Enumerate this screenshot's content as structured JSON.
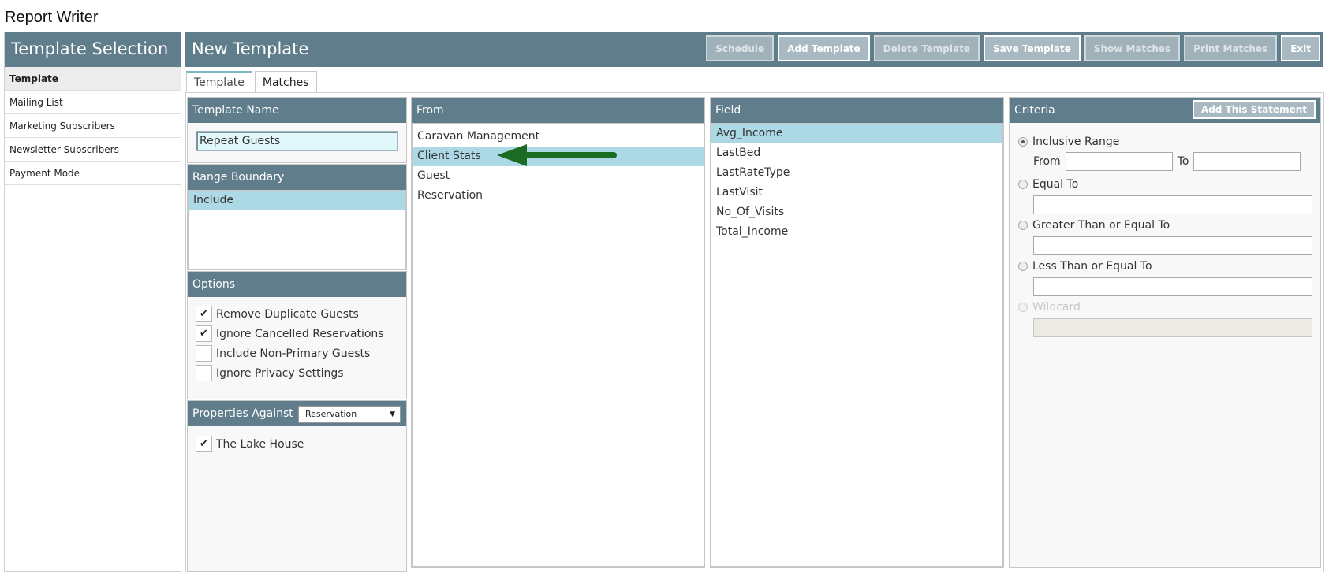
{
  "app": {
    "title": "Report Writer"
  },
  "sidebar": {
    "header": "Template Selection",
    "items": [
      {
        "label": "Template",
        "active": true
      },
      {
        "label": "Mailing List"
      },
      {
        "label": "Marketing Subscribers"
      },
      {
        "label": "Newsletter Subscribers"
      },
      {
        "label": "Payment Mode"
      }
    ]
  },
  "main": {
    "title": "New Template",
    "toolbar": {
      "schedule": "Schedule",
      "add_template": "Add Template",
      "delete_template": "Delete Template",
      "save_template": "Save Template",
      "show_matches": "Show Matches",
      "print_matches": "Print Matches",
      "exit": "Exit"
    },
    "tabs": [
      "Template",
      "Matches"
    ]
  },
  "template_name": {
    "header": "Template Name",
    "value": "Repeat Guests"
  },
  "range_boundary": {
    "header": "Range Boundary",
    "items": [
      "Include"
    ]
  },
  "options": {
    "header": "Options",
    "items": [
      {
        "label": "Remove Duplicate Guests",
        "checked": true
      },
      {
        "label": "Ignore Cancelled Reservations",
        "checked": true
      },
      {
        "label": "Include Non-Primary Guests",
        "checked": false
      },
      {
        "label": "Ignore Privacy Settings",
        "checked": false
      }
    ]
  },
  "properties": {
    "header": "Properties Against",
    "select_value": "Reservation",
    "items": [
      {
        "label": "The Lake House",
        "checked": true
      }
    ]
  },
  "from": {
    "header": "From",
    "items": [
      "Caravan Management",
      "Client Stats",
      "Guest",
      "Reservation"
    ],
    "selected": "Client Stats"
  },
  "field": {
    "header": "Field",
    "items": [
      "Avg_Income",
      "LastBed",
      "LastRateType",
      "LastVisit",
      "No_Of_Visits",
      "Total_Income"
    ],
    "selected": "Avg_Income"
  },
  "criteria": {
    "header": "Criteria",
    "add_statement": "Add This Statement",
    "inclusive_range": "Inclusive Range",
    "from_label": "From",
    "to_label": "To",
    "equal_to": "Equal To",
    "greater_than_or_equal_to": "Greater Than or Equal To",
    "less_than_or_equal_to": "Less Than or Equal To",
    "wildcard": "Wildcard"
  },
  "colors": {
    "header_bg": "#607d8b",
    "selected_row": "#add8e6",
    "annotation_arrow": "#1b6b22"
  },
  "annotation": {
    "icon": "arrow-left-icon"
  }
}
